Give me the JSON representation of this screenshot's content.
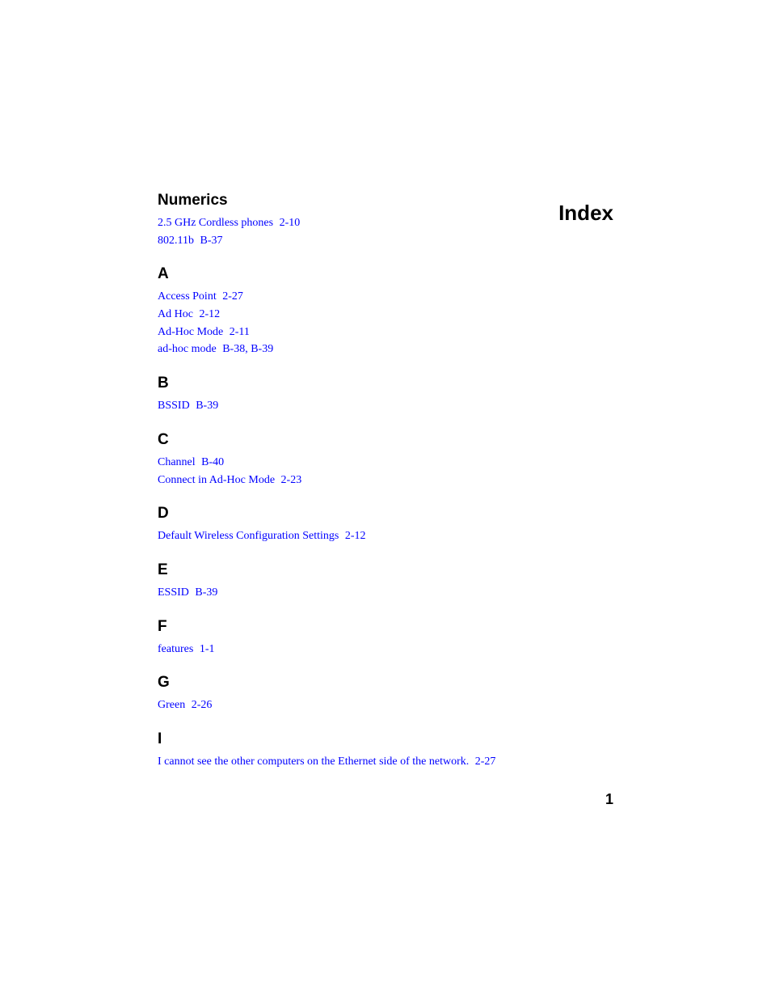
{
  "title": "Index",
  "page_number": "1",
  "sections": [
    {
      "heading": "Numerics",
      "entries": [
        {
          "term": "2.5 GHz Cordless phones",
          "pages": "2-10"
        },
        {
          "term": "802.11b",
          "pages": "B-37"
        }
      ]
    },
    {
      "heading": "A",
      "entries": [
        {
          "term": "Access Point",
          "pages": "2-27"
        },
        {
          "term": "Ad Hoc",
          "pages": "2-12"
        },
        {
          "term": "Ad-Hoc Mode",
          "pages": "2-11"
        },
        {
          "term": "ad-hoc mode",
          "pages": "B-38, B-39"
        }
      ]
    },
    {
      "heading": "B",
      "entries": [
        {
          "term": "BSSID",
          "pages": "B-39"
        }
      ]
    },
    {
      "heading": "C",
      "entries": [
        {
          "term": "Channel",
          "pages": "B-40"
        },
        {
          "term": "Connect in Ad-Hoc Mode",
          "pages": "2-23"
        }
      ]
    },
    {
      "heading": "D",
      "entries": [
        {
          "term": "Default Wireless Configuration Settings",
          "pages": "2-12"
        }
      ]
    },
    {
      "heading": "E",
      "entries": [
        {
          "term": "ESSID",
          "pages": "B-39"
        }
      ]
    },
    {
      "heading": "F",
      "entries": [
        {
          "term": "features",
          "pages": "1-1"
        }
      ]
    },
    {
      "heading": "G",
      "entries": [
        {
          "term": "Green",
          "pages": "2-26"
        }
      ]
    },
    {
      "heading": "I",
      "entries": [
        {
          "term": "I cannot see the other computers on the Ethernet side of the network.",
          "pages": "2-27"
        }
      ]
    }
  ]
}
